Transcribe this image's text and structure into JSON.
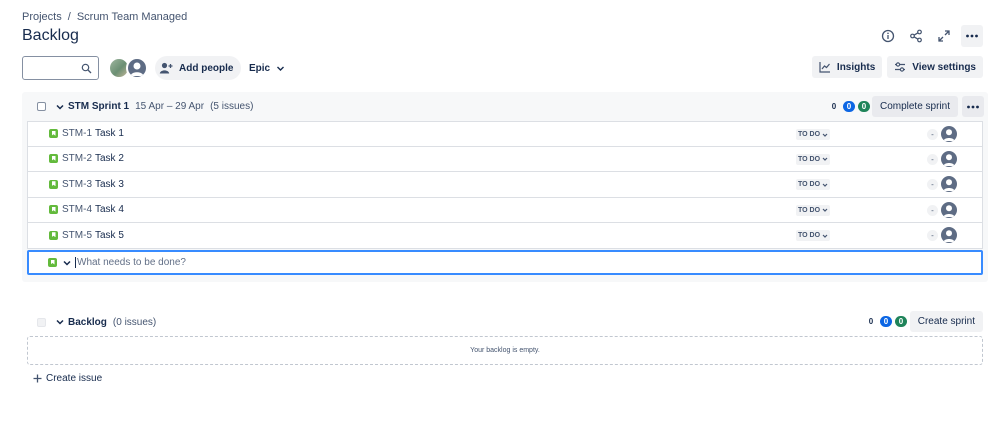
{
  "breadcrumb": {
    "root": "Projects",
    "separator": "/",
    "project": "Scrum Team Managed"
  },
  "page": {
    "title": "Backlog"
  },
  "header_icons": [
    "info-icon",
    "share-icon",
    "expand-icon",
    "more-icon"
  ],
  "toolbar": {
    "search": {
      "placeholder": "",
      "value": ""
    },
    "add_people_label": "Add people",
    "epic_label": "Epic",
    "insights_label": "Insights",
    "view_settings_label": "View settings"
  },
  "sprint": {
    "name": "STM Sprint 1",
    "dates": "15 Apr – 29 Apr",
    "issue_count": "(5 issues)",
    "counts": {
      "todo": "0",
      "in_progress": "0",
      "done": "0"
    },
    "complete_label": "Complete sprint",
    "issues": [
      {
        "key": "STM-1",
        "summary": "Task 1",
        "status": "TO DO",
        "estimate": "-"
      },
      {
        "key": "STM-2",
        "summary": "Task 2",
        "status": "TO DO",
        "estimate": "-"
      },
      {
        "key": "STM-3",
        "summary": "Task 3",
        "status": "TO DO",
        "estimate": "-"
      },
      {
        "key": "STM-4",
        "summary": "Task 4",
        "status": "TO DO",
        "estimate": "-"
      },
      {
        "key": "STM-5",
        "summary": "Task 5",
        "status": "TO DO",
        "estimate": "-"
      }
    ],
    "create_placeholder": "What needs to be done?"
  },
  "backlog": {
    "name": "Backlog",
    "issue_count": "(0 issues)",
    "counts": {
      "todo": "0",
      "in_progress": "0",
      "done": "0"
    },
    "create_sprint_label": "Create sprint",
    "empty_text": "Your backlog is empty.",
    "create_issue_label": "Create issue"
  },
  "colors": {
    "accent": "#0c66e4",
    "done": "#1f845a",
    "story": "#63ba3c",
    "focus": "#388bff"
  }
}
